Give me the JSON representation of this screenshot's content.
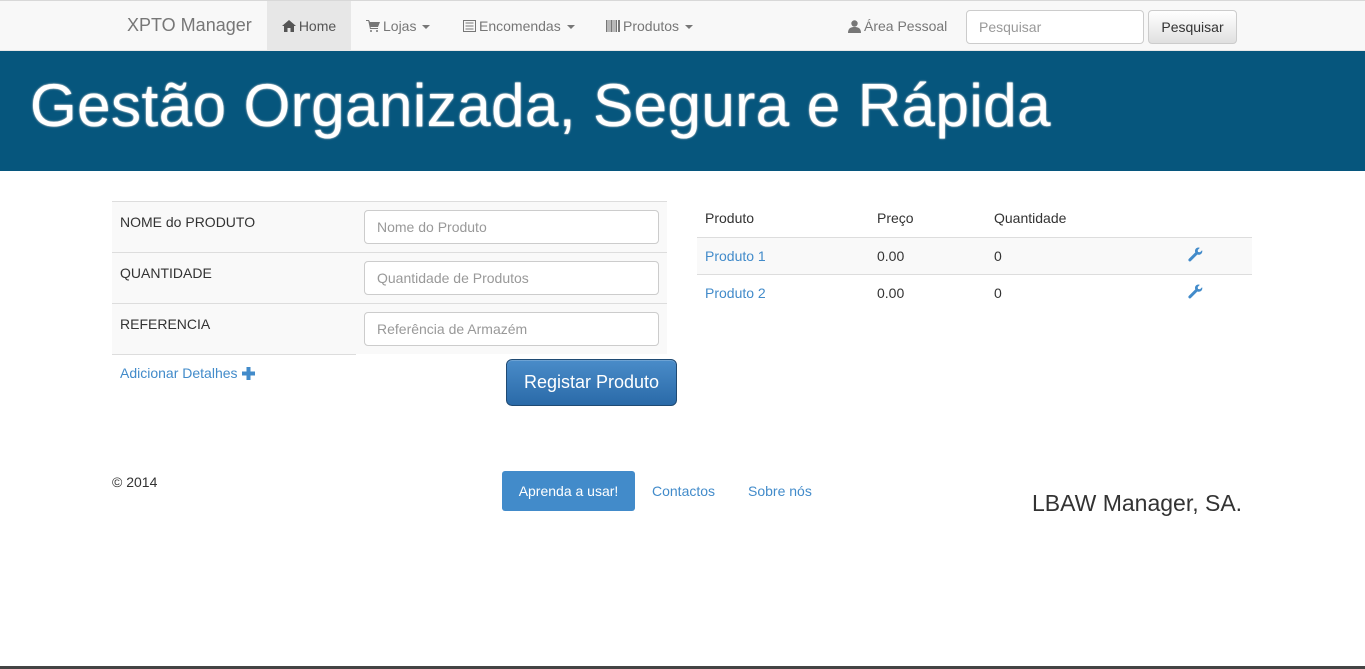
{
  "navbar": {
    "brand": "XPTO Manager",
    "home": "Home",
    "stores": "Lojas",
    "orders": "Encomendas",
    "products": "Produtos",
    "personal_area": "Área Pessoal",
    "search_placeholder": "Pesquisar",
    "search_button": "Pesquisar"
  },
  "hero": {
    "title": "Gestão Organizada, Segura e Rápida"
  },
  "form": {
    "rows": [
      {
        "label": "NOME do PRODUTO",
        "placeholder": "Nome do Produto"
      },
      {
        "label": "QUANTIDADE",
        "placeholder": "Quantidade de Produtos"
      },
      {
        "label": "REFERENCIA",
        "placeholder": "Referência de Armazém"
      }
    ],
    "add_details": "Adicionar Detalhes",
    "submit": "Registar Produto"
  },
  "products_table": {
    "headers": [
      "Produto",
      "Preço",
      "Quantidade"
    ],
    "rows": [
      {
        "name": "Produto 1",
        "price": "0.00",
        "quantity": "0"
      },
      {
        "name": "Produto 2",
        "price": "0.00",
        "quantity": "0"
      }
    ]
  },
  "footer": {
    "copyright": "© 2014",
    "learn_button": "Aprenda a usar!",
    "contacts": "Contactos",
    "about": "Sobre nós",
    "company": "LBAW Manager, SA."
  },
  "colors": {
    "hero_bg": "#06567d",
    "link": "#428bca",
    "primary_btn": "#428bca"
  }
}
